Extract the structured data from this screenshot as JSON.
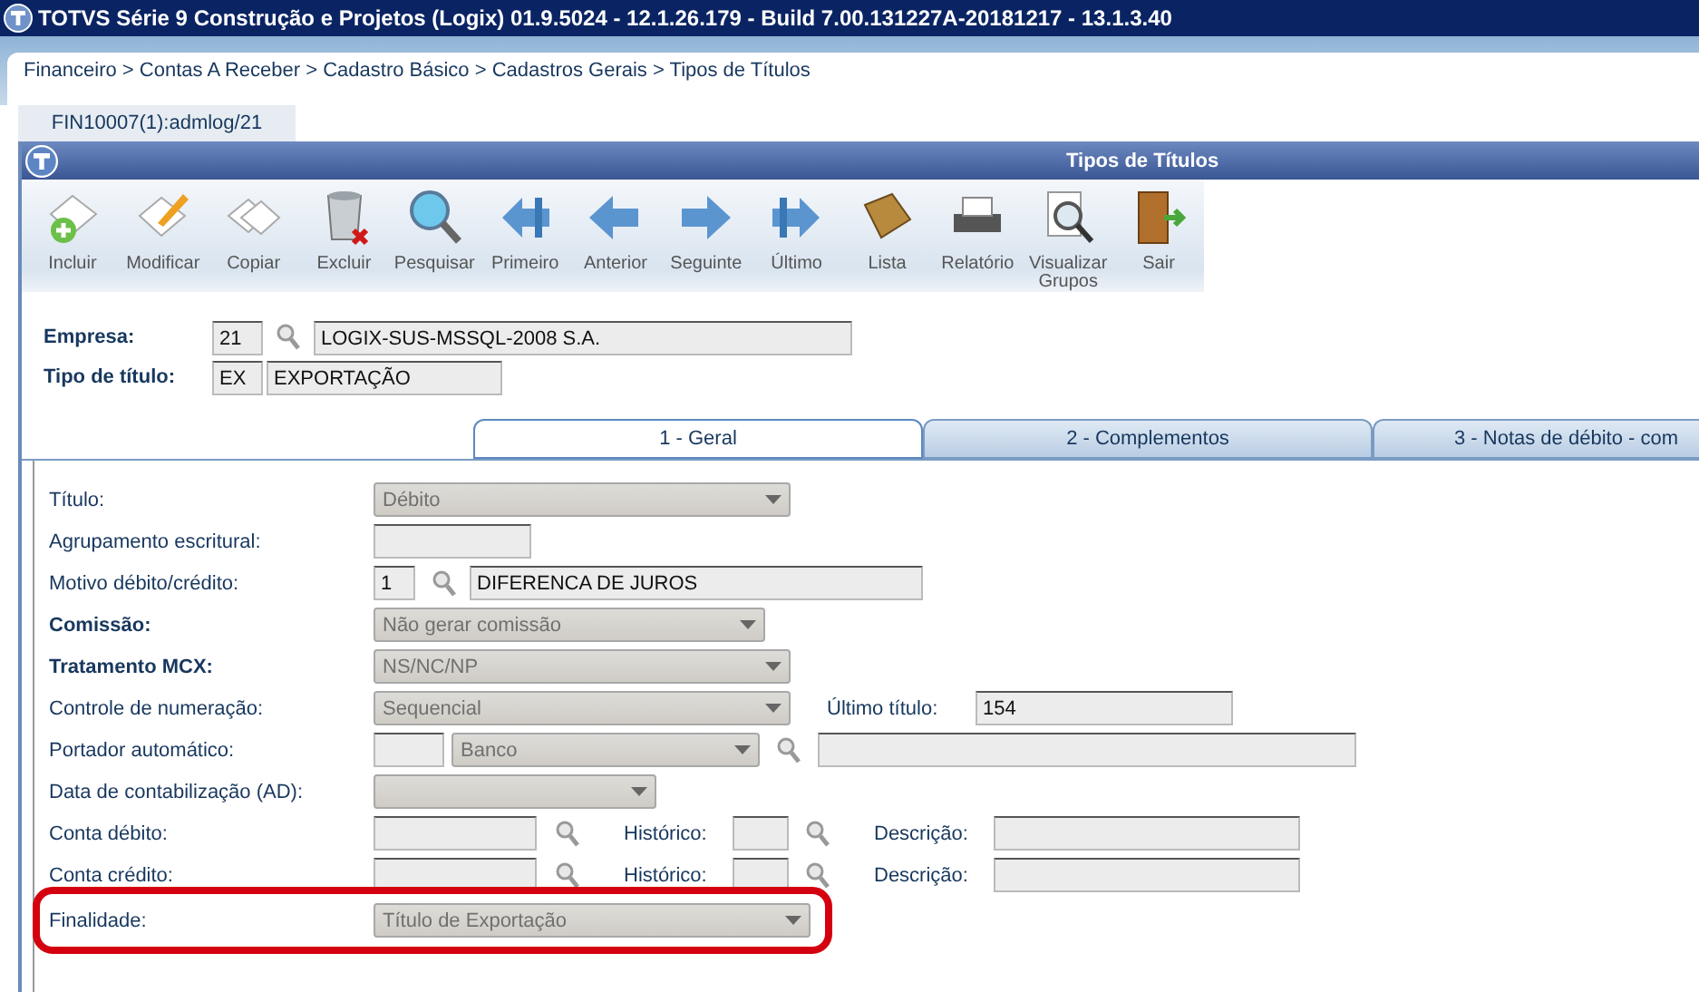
{
  "window": {
    "title": "TOTVS Série 9 Construção e Projetos (Logix) 01.9.5024  -  12.1.26.179 - Build 7.00.131227A-20181217 - 13.1.3.40"
  },
  "breadcrumb": "Financeiro > Contas A Receber > Cadastro Básico > Cadastros Gerais > Tipos de Títulos",
  "program_tab": "FIN10007(1):admlog/21",
  "form_window": {
    "title": "Tipos de Títulos"
  },
  "toolbar": [
    {
      "label": "Incluir"
    },
    {
      "label": "Modificar"
    },
    {
      "label": "Copiar"
    },
    {
      "label": "Excluir"
    },
    {
      "label": "Pesquisar"
    },
    {
      "label": "Primeiro"
    },
    {
      "label": "Anterior"
    },
    {
      "label": "Seguinte"
    },
    {
      "label": "Último"
    },
    {
      "label": "Lista"
    },
    {
      "label": "Relatório"
    },
    {
      "label": "Visualizar Grupos"
    },
    {
      "label": "Sair"
    }
  ],
  "header": [
    {
      "label": "Empresa:",
      "code": "21",
      "lookup": true,
      "description": "LOGIX-SUS-MSSQL-2008 S.A."
    },
    {
      "label": "Tipo de título:",
      "code": "EX",
      "lookup": false,
      "description": "EXPORTAÇÃO"
    }
  ],
  "tabs": [
    {
      "label": "1 - Geral",
      "selected": true
    },
    {
      "label": "2 - Complementos",
      "selected": false
    },
    {
      "label": "3 - Notas de débito - com",
      "selected": false
    }
  ],
  "rows": [
    {
      "label": "Título:",
      "bold": false,
      "highlighted": false,
      "controls": [
        {
          "kind": "select",
          "value": "Débito"
        }
      ]
    },
    {
      "label": "Agrupamento escritural:",
      "bold": false,
      "highlighted": false,
      "controls": [
        {
          "kind": "input"
        }
      ]
    },
    {
      "label": "Motivo débito/crédito:",
      "bold": false,
      "highlighted": false,
      "controls": [
        {
          "kind": "input",
          "value": "1"
        },
        {
          "kind": "lookup"
        },
        {
          "kind": "input",
          "value": "DIFERENCA DE JUROS"
        }
      ]
    },
    {
      "label": "Comissão:",
      "bold": true,
      "highlighted": false,
      "controls": [
        {
          "kind": "select",
          "value": "Não gerar comissão"
        }
      ]
    },
    {
      "label": "Tratamento MCX:",
      "bold": true,
      "highlighted": false,
      "controls": [
        {
          "kind": "select",
          "value": "NS/NC/NP"
        }
      ]
    },
    {
      "label": "Controle de numeração:",
      "bold": false,
      "highlighted": false,
      "controls": [
        {
          "kind": "select",
          "value": "Sequencial"
        },
        {
          "kind": "label",
          "text": "Último título:"
        },
        {
          "kind": "input",
          "value": "154"
        }
      ]
    },
    {
      "label": "Portador automático:",
      "bold": false,
      "highlighted": false,
      "controls": [
        {
          "kind": "input"
        },
        {
          "kind": "select",
          "value": "Banco"
        },
        {
          "kind": "lookup"
        },
        {
          "kind": "input"
        }
      ]
    },
    {
      "label": "Data de contabilização (AD):",
      "bold": false,
      "highlighted": false,
      "controls": [
        {
          "kind": "select"
        }
      ]
    },
    {
      "label": "Conta débito:",
      "bold": false,
      "highlighted": false,
      "controls": [
        {
          "kind": "input"
        },
        {
          "kind": "lookup"
        },
        {
          "kind": "label",
          "text": "Histórico:"
        },
        {
          "kind": "input"
        },
        {
          "kind": "lookup"
        },
        {
          "kind": "label",
          "text": "Descrição:"
        },
        {
          "kind": "input"
        }
      ]
    },
    {
      "label": "Conta crédito:",
      "bold": false,
      "highlighted": false,
      "controls": [
        {
          "kind": "input"
        },
        {
          "kind": "lookup"
        },
        {
          "kind": "label",
          "text": "Histórico:"
        },
        {
          "kind": "input"
        },
        {
          "kind": "lookup"
        },
        {
          "kind": "label",
          "text": "Descrição:"
        },
        {
          "kind": "input"
        }
      ]
    },
    {
      "label": "Finalidade:",
      "bold": false,
      "highlighted": true,
      "controls": [
        {
          "kind": "select",
          "value": "Título de Exportação"
        }
      ]
    }
  ]
}
